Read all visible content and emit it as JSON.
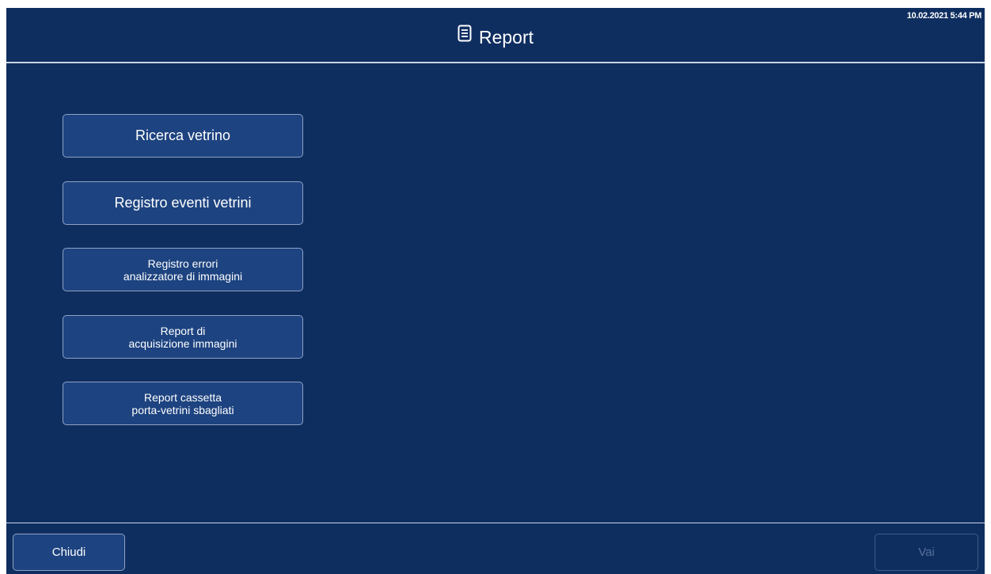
{
  "header": {
    "title": "Report",
    "title_icon": "document-icon",
    "timestamp": "10.02.2021 5:44 PM"
  },
  "menu": {
    "buttons": [
      {
        "lines": [
          "Ricerca vetrino"
        ]
      },
      {
        "lines": [
          "Registro eventi vetrini"
        ]
      },
      {
        "lines": [
          "Registro errori",
          "analizzatore di immagini"
        ]
      },
      {
        "lines": [
          "Report di",
          "acquisizione immagini"
        ]
      },
      {
        "lines": [
          "Report cassetta",
          "porta-vetrini sbagliati"
        ]
      }
    ]
  },
  "footer": {
    "close_label": "Chiudi",
    "go_label": "Vai"
  },
  "colors": {
    "background": "#0f2e60",
    "button": "#1d4380",
    "button_border": "#8ea2c4",
    "disabled_text": "#55709b"
  }
}
